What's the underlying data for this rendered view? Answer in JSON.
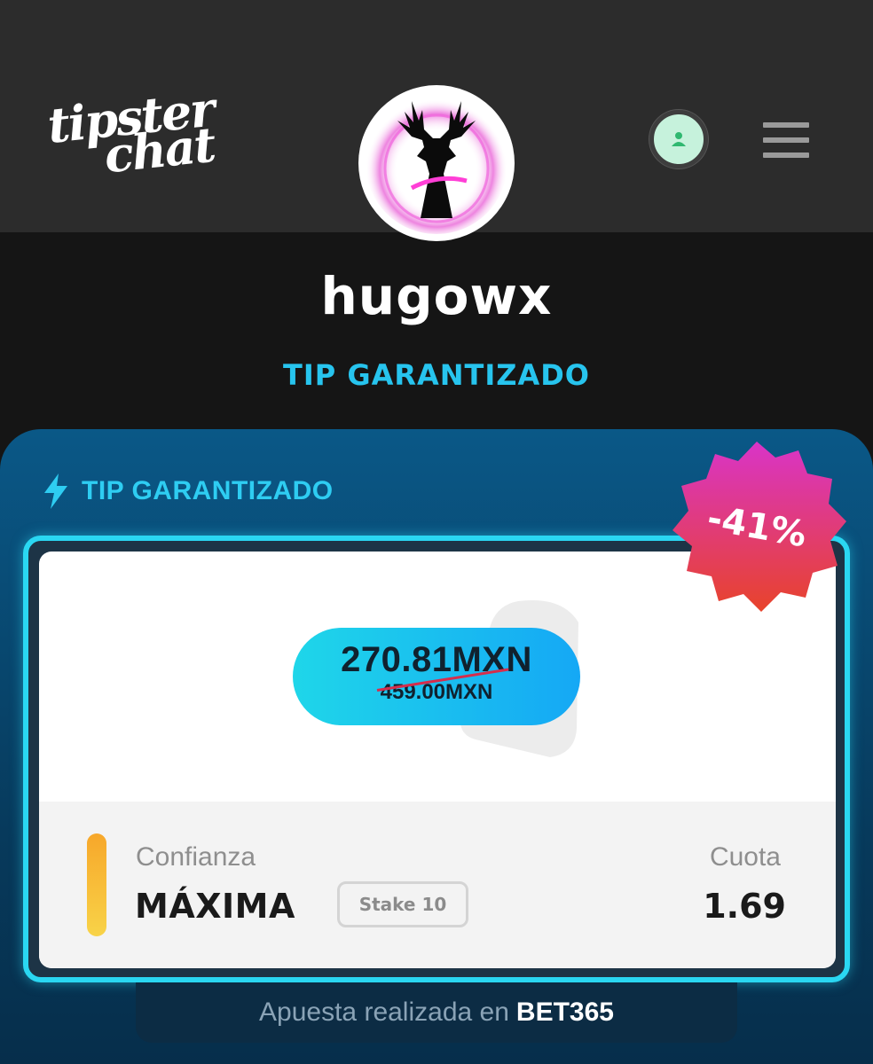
{
  "header": {
    "logo_line1": "tipster",
    "logo_line2": "chat"
  },
  "profile": {
    "username": "hugowx",
    "section_heading": "TIP GARANTIZADO"
  },
  "tip_card": {
    "title": "TIP GARANTIZADO",
    "discount_badge": "-41%",
    "price_new": "270.81MXN",
    "price_old": "459.00MXN",
    "confidence_label": "Confianza",
    "confidence_value": "MÁXIMA",
    "stake_label": "Stake 10",
    "odds_label": "Cuota",
    "odds_value": "1.69",
    "bet_placed_prefix": "Apuesta realizada en",
    "bookmaker": "BET365"
  },
  "colors": {
    "accent_cyan": "#27c4ee",
    "badge_top": "#d934c8",
    "badge_bottom": "#e8432a",
    "confidence_bar": "#f7b035",
    "user_icon": "#2fb870"
  },
  "icons": {
    "user_button": "user-icon",
    "menu": "hamburger-menu-icon",
    "tip_title": "lightning-icon",
    "card_watermark": "price-tag-icon"
  }
}
